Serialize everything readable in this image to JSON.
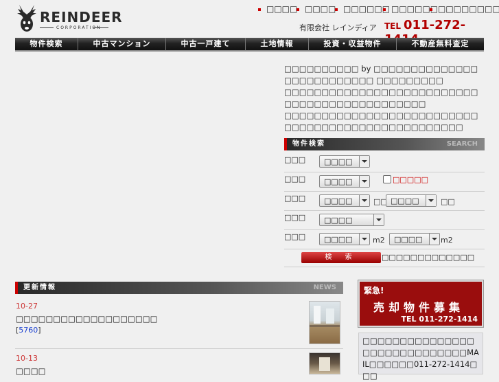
{
  "header": {
    "brand": "REINDEER",
    "brand_sub": "CORPORATION",
    "top_links": [
      "□□□□",
      "□□□□",
      "□□□□□□",
      "□□□□□□",
      "□□□□□□□□□□"
    ],
    "company": "有限会社 レインディア",
    "tel_label": "TEL",
    "tel_number": "011-272-1414"
  },
  "nav": [
    "物件検索",
    "中古マンション",
    "中古一戸建て",
    "土地情報",
    "投資・収益物件",
    "不動産無料査定"
  ],
  "intro": [
    "□□□□□□□□□□ by □□□□□□□□□□□□□□□□□□□□□□□□□□ □□□□□□□□□",
    "□□□□□□□□□□□□□□□□□□□□□□□□□□□□□□□□□□□□□□□□□□□□□",
    "□□□□□□□□□□□□□□□□□□□□□□□□□□□□□□□□□□□□□□□□□□□□□□□□□□"
  ],
  "search": {
    "header": "物件検索",
    "header_en": "SEARCH",
    "rows": [
      {
        "label": "□□□",
        "select1": "□□□□"
      },
      {
        "label": "□□□",
        "select1": "□□□□",
        "checkbox_label": "□□□□□"
      },
      {
        "label": "□□□",
        "select1": "□□□□",
        "unit1": "□□",
        "select2": "□□□□",
        "unit2": "□□"
      },
      {
        "label": "□□□",
        "select1": "□□□□"
      },
      {
        "label": "□□□",
        "select1": "□□□□",
        "unit1": "m2",
        "select2": "□□□□",
        "unit2": "m2"
      }
    ],
    "button": "検 索",
    "note": "□□□□□□□□□□□□□"
  },
  "news": {
    "header": "更新情報",
    "header_en": "NEWS",
    "items": [
      {
        "date": "10-27",
        "title": "□□□□□□□□□□□□□□□□□□□",
        "id": "5760"
      },
      {
        "date": "10-13",
        "title": "□□□□"
      }
    ]
  },
  "banner": {
    "line1": "緊急!",
    "line2": "売却物件募集",
    "tel": "TEL 011-272-1414",
    "text": "□□□□□□□□□□□□□□□□□□□□□□□□□□□□□MAIL□□□□□□011-272-1414□□□"
  },
  "colors": {
    "accent": "#b20000",
    "nav_bg": "#222222",
    "background": "#f0f0f0"
  }
}
